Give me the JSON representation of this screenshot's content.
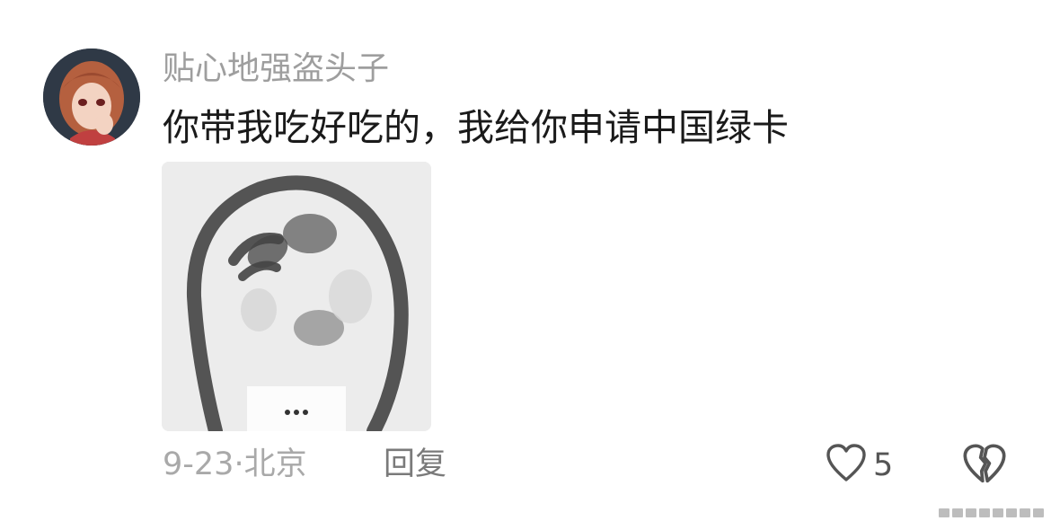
{
  "comment": {
    "username": "贴心地强盗头子",
    "text": "你带我吃好吃的，我给你申请中国绿卡",
    "date": "9-23",
    "separator": "·",
    "location": "北京",
    "reply_label": "回复",
    "like_count": "5"
  },
  "icons": {
    "like": "heart-outline-icon",
    "dislike": "broken-heart-icon"
  },
  "colors": {
    "username": "#9e9e9e",
    "text": "#1a1a1a",
    "meta": "#a9a9a9",
    "reply": "#7a7a7a",
    "icon": "#555555"
  }
}
